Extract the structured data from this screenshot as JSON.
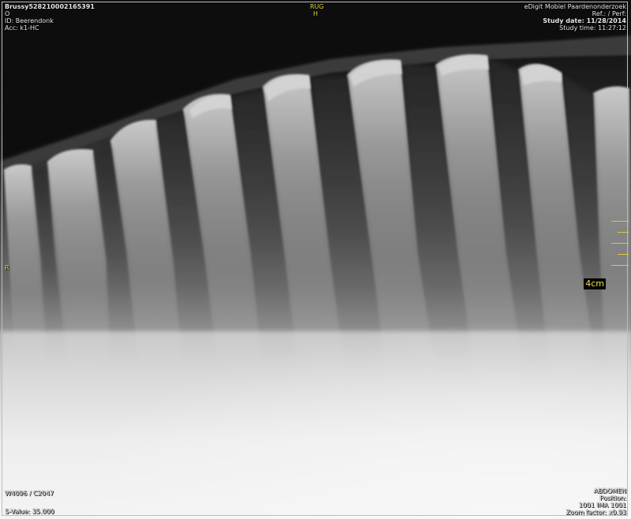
{
  "overlay": {
    "top_left": {
      "patient_name": "Brussy528210002165391",
      "line2": "O",
      "id": "ID: Beerendonk",
      "acc": "Acc: k1-HC"
    },
    "top_center": {
      "orientation_top": "RUG",
      "orientation_sub": "H"
    },
    "top_right": {
      "institution": "eDigit Mobiel Paardenonderzoek",
      "ref": "Ref.: / Perf:",
      "study_date": "Study date: 11/28/2014",
      "study_time": "Study time: 11:27:12"
    },
    "left_marker": "R",
    "scale_label": "4cm",
    "bottom_left": {
      "window": "W4096 / C2047",
      "svalue": "S-Value: 35.000"
    },
    "bottom_right": {
      "body_part": "ABDOMEN",
      "position_label": "Position:",
      "image_info": "1001 IMA 1001",
      "zoom": "Zoom factor: x0.93"
    }
  },
  "image": {
    "subject": "lateral radiograph of equine thoracic spine dorsal spinous processes",
    "colors": {
      "overlay_text": "#e6e6e6",
      "marker": "#e3d23c",
      "border": "#bdbdbd"
    }
  }
}
